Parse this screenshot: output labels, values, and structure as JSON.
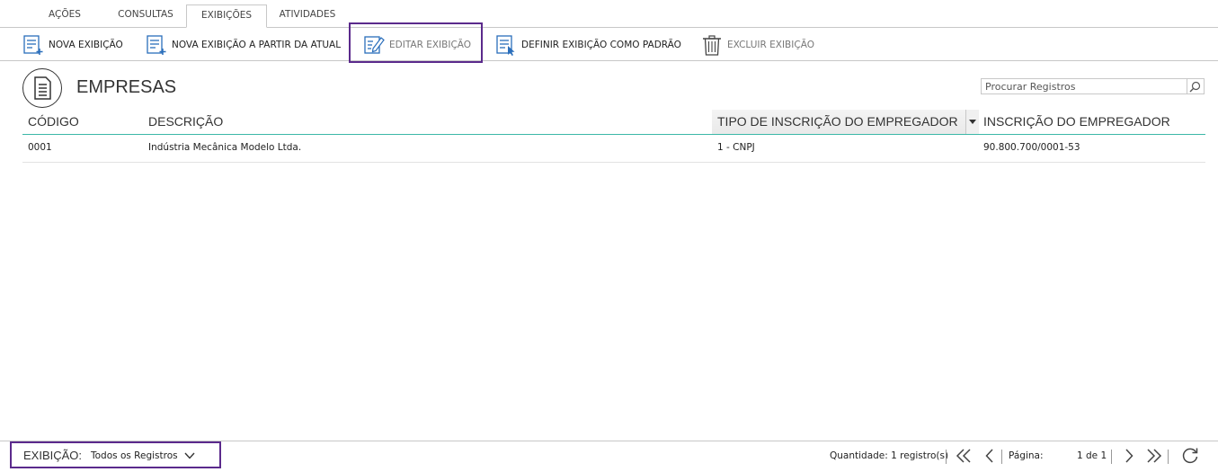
{
  "tabs": [
    {
      "label": "AÇÕES"
    },
    {
      "label": "CONSULTAS"
    },
    {
      "label": "EXIBIÇÕES",
      "active": true
    },
    {
      "label": "ATIVIDADES"
    }
  ],
  "ribbon": {
    "new_view": "NOVA EXIBIÇÃO",
    "new_from_current": "NOVA EXIBIÇÃO A PARTIR DA ATUAL",
    "edit_view": "EDITAR EXIBIÇÃO",
    "set_default": "DEFINIR EXIBIÇÃO COMO PADRÃO",
    "delete_view": "EXCLUIR EXIBIÇÃO"
  },
  "page": {
    "title": "EMPRESAS",
    "search_placeholder": "Procurar Registros"
  },
  "table": {
    "columns": [
      "CÓDIGO",
      "DESCRIÇÃO",
      "TIPO DE INSCRIÇÃO DO EMPREGADOR",
      "INSCRIÇÃO DO EMPREGADOR"
    ],
    "rows": [
      [
        "0001",
        "Indústria Mecânica Modelo Ltda.",
        "1 - CNPJ",
        "90.800.700/0001-53"
      ]
    ]
  },
  "footer": {
    "view_label": "EXIBIÇÃO:",
    "view_value": "Todos os Registros",
    "quantity": "Quantidade: 1 registro(s)",
    "page_label": "Página:",
    "page_value": "1 de 1"
  },
  "colors": {
    "accent": "#3cb8a8",
    "highlight_border": "#5b2a8c",
    "icon_blue": "#2a6ebb"
  }
}
